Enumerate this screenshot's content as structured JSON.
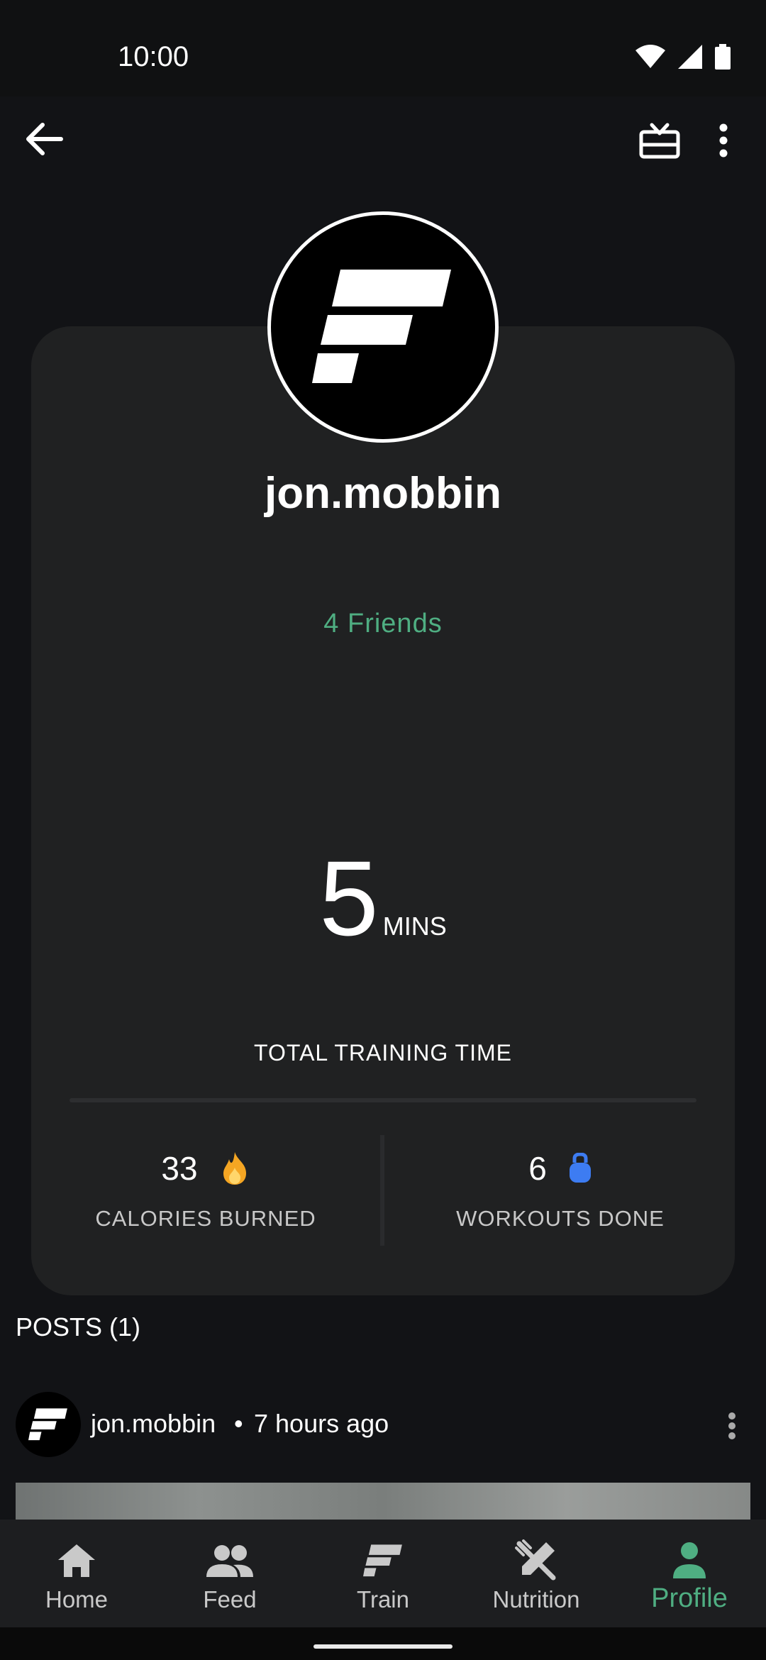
{
  "status_bar": {
    "time": "10:00"
  },
  "profile": {
    "username": "jon.mobbin",
    "friends": "4 Friends",
    "training_time": {
      "value": "5",
      "unit": "MINS",
      "label": "TOTAL TRAINING TIME"
    },
    "calories": {
      "value": "33",
      "label": "CALORIES BURNED"
    },
    "workouts": {
      "value": "6",
      "label": "WORKOUTS DONE"
    }
  },
  "posts": {
    "title": "POSTS (1)",
    "items": [
      {
        "username": "jon.mobbin",
        "separator": "•",
        "time": "7 hours ago"
      }
    ]
  },
  "bottom_nav": {
    "items": [
      {
        "label": "Home",
        "icon": "home-icon"
      },
      {
        "label": "Feed",
        "icon": "people-icon"
      },
      {
        "label": "Train",
        "icon": "train-logo-icon"
      },
      {
        "label": "Nutrition",
        "icon": "fork-knife-icon"
      },
      {
        "label": "Profile",
        "icon": "person-icon",
        "active": true
      }
    ]
  },
  "colors": {
    "accent": "#4fae82",
    "card": "#202122",
    "background": "#121316"
  }
}
